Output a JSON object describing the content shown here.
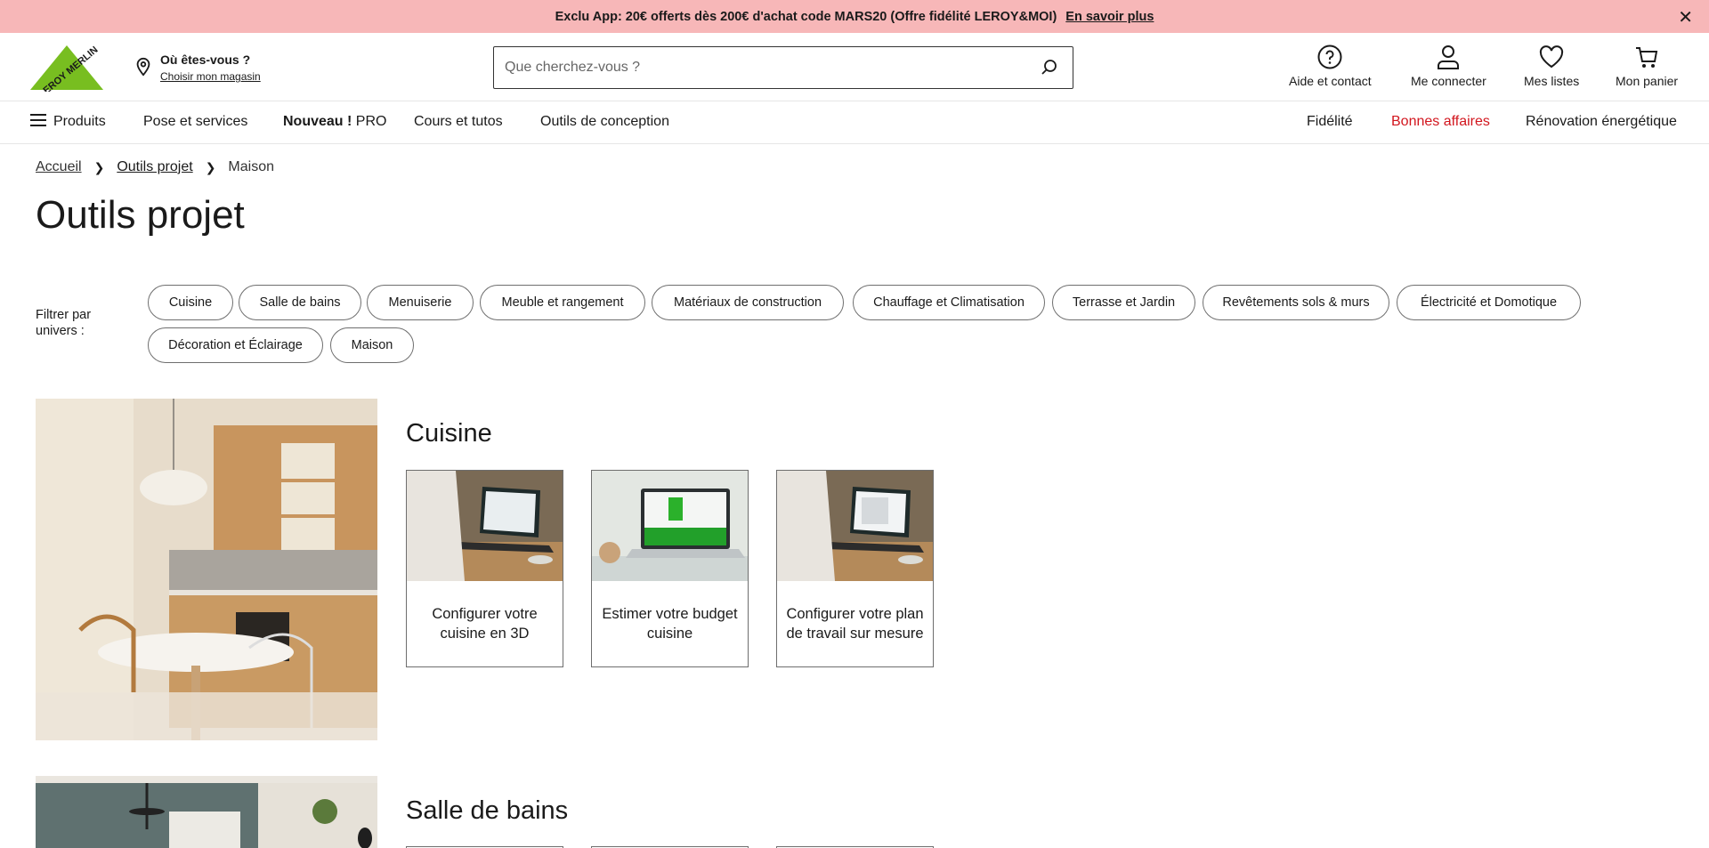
{
  "promo": {
    "text": "Exclu App: 20€ offerts dès 200€ d'achat code MARS20 (Offre fidélité LEROY&MOI)",
    "link": "En savoir plus"
  },
  "header": {
    "logo_text": "LEROY MERLIN",
    "store_question": "Où êtes-vous ?",
    "store_link": "Choisir mon magasin",
    "search_placeholder": "Que cherchez-vous ?",
    "help": "Aide et contact",
    "login": "Me connecter",
    "lists": "Mes listes",
    "cart": "Mon panier"
  },
  "nav": {
    "products": "Produits",
    "services": "Pose et services",
    "new_pro_bold": "Nouveau !",
    "new_pro": "PRO",
    "courses": "Cours et tutos",
    "design": "Outils de conception",
    "loyalty": "Fidélité",
    "deals": "Bonnes affaires",
    "renovation": "Rénovation énergétique"
  },
  "breadcrumb": {
    "home": "Accueil",
    "tools": "Outils projet",
    "current": "Maison"
  },
  "page_title": "Outils projet",
  "filters": {
    "label": "Filtrer par univers :",
    "chips": [
      "Cuisine",
      "Salle de bains",
      "Menuiserie",
      "Meuble et rangement",
      "Matériaux de construction",
      "Chauffage et Climatisation",
      "Terrasse et Jardin",
      "Revêtements sols & murs",
      "Électricité et Domotique",
      "Décoration et Éclairage",
      "Maison"
    ]
  },
  "sections": [
    {
      "title": "Cuisine",
      "cards": [
        "Configurer votre cuisine en 3D",
        "Estimer votre budget cuisine",
        "Configurer votre plan de travail sur mesure"
      ]
    },
    {
      "title": "Salle de bains"
    }
  ],
  "colors": {
    "promo_bg": "#f7b7b8",
    "brand_green": "#78be20",
    "deals_red": "#d2161e"
  },
  "icons": [
    "close-icon",
    "location-pin-icon",
    "search-icon",
    "help-icon",
    "user-icon",
    "heart-icon",
    "cart-icon",
    "menu-icon",
    "chevron-right-icon"
  ]
}
